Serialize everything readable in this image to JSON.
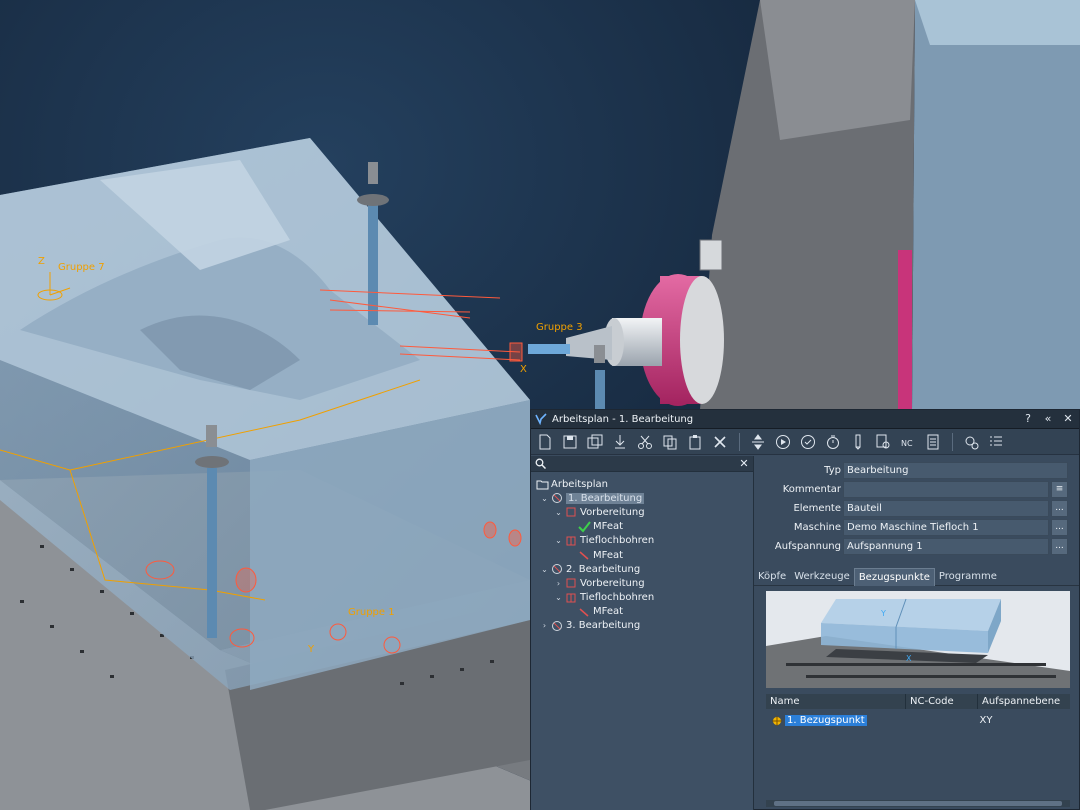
{
  "scene": {
    "labels": [
      "Gruppe 7",
      "Gruppe 3",
      "Gruppe 1"
    ],
    "axis_letters": [
      "Z",
      "X",
      "Y"
    ]
  },
  "panel": {
    "title": "Arbeitsplan - 1. Bearbeitung",
    "window_buttons": [
      "?",
      "«",
      "✕"
    ],
    "search": {
      "value": "",
      "clear": "✕"
    },
    "tree": {
      "root": "Arbeitsplan",
      "items": [
        {
          "label": "1. Bearbeitung",
          "children": [
            {
              "label": "Vorbereitung",
              "children": [
                {
                  "label": "MFeat"
                }
              ]
            },
            {
              "label": "Tieflochbohren",
              "children": [
                {
                  "label": "MFeat"
                }
              ]
            }
          ]
        },
        {
          "label": "2. Bearbeitung",
          "children": [
            {
              "label": "Vorbereitung"
            },
            {
              "label": "Tieflochbohren",
              "children": [
                {
                  "label": "MFeat"
                }
              ]
            }
          ]
        },
        {
          "label": "3. Bearbeitung"
        }
      ]
    },
    "properties": {
      "typ": {
        "label": "Typ",
        "value": "Bearbeitung"
      },
      "kommentar": {
        "label": "Kommentar",
        "value": ""
      },
      "elemente": {
        "label": "Elemente",
        "value": "Bauteil"
      },
      "maschine": {
        "label": "Maschine",
        "value": "Demo Maschine Tiefloch 1"
      },
      "aufspannung": {
        "label": "Aufspannung",
        "value": "Aufspannung 1"
      }
    },
    "ellipsis": "...",
    "tabs": [
      "Köpfe",
      "Werkzeuge",
      "Bezugspunkte",
      "Programme"
    ],
    "active_tab": "Bezugspunkte",
    "table": {
      "columns": [
        "Name",
        "NC-Code",
        "Aufspannebene"
      ],
      "rows": [
        {
          "name": "1. Bezugspunkt",
          "nc_code": "",
          "plane": "XY"
        }
      ]
    }
  },
  "colors": {
    "background": "#15263b",
    "panel": "#3a4b5e",
    "selection": "#2b7fd9",
    "feature_orange": "#f0a000",
    "spindle_magenta": "#c8347a"
  }
}
